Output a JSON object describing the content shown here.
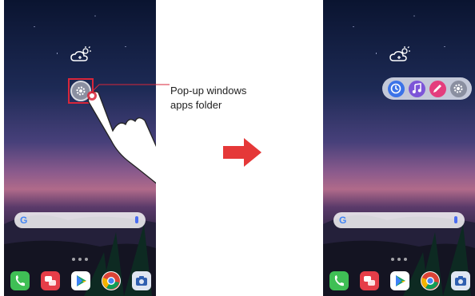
{
  "callout": {
    "line1": "Pop-up windows",
    "line2": "apps folder"
  },
  "search": {
    "logo_letter": "G"
  },
  "colors": {
    "highlight": "#d8263a",
    "arrow": "#e53838"
  },
  "icons": {
    "weather": "weather-icon",
    "settings": "gear-icon",
    "hand": "pointing-hand-icon",
    "arrow": "right-arrow-icon",
    "dock": [
      "phone-icon",
      "messages-icon",
      "play-store-icon",
      "chrome-icon",
      "camera-icon"
    ],
    "popup": [
      "clock-icon",
      "music-icon",
      "pen-icon",
      "gear-icon"
    ]
  }
}
